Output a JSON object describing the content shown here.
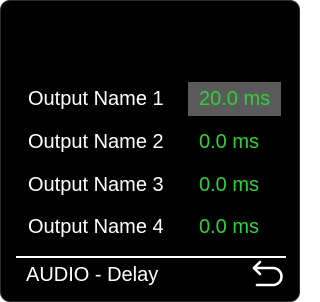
{
  "outputs": [
    {
      "label": "Output Name 1",
      "value": "20.0 ms",
      "selected": true
    },
    {
      "label": "Output Name 2",
      "value": "0.0 ms",
      "selected": false
    },
    {
      "label": "Output Name 3",
      "value": "0.0 ms",
      "selected": false
    },
    {
      "label": "Output Name 4",
      "value": "0.0 ms",
      "selected": false
    }
  ],
  "footer": {
    "title": "AUDIO - Delay",
    "back_icon": "return-arrow-icon"
  },
  "colors": {
    "background": "#000000",
    "label_text": "#ffffff",
    "value_text": "#2fd13a",
    "selected_highlight": "#5a5a5a"
  }
}
